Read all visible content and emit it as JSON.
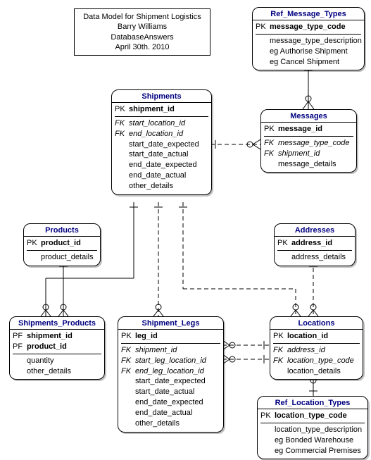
{
  "title_box": {
    "line1": "Data Model for Shipment Logistics",
    "line2": "Barry Williams",
    "line3": "DatabaseAnswers",
    "line4": "April 30th. 2010"
  },
  "entities": {
    "ref_message_types": {
      "title": "Ref_Message_Types",
      "pk_rows": [
        {
          "key": "PK",
          "name": "message_type_code",
          "cls": "pk-name"
        }
      ],
      "rows": [
        {
          "key": "",
          "name": "message_type_description",
          "cls": ""
        },
        {
          "key": "",
          "name": "eg Authorise Shipment",
          "cls": ""
        },
        {
          "key": "",
          "name": "eg Cancel Shipment",
          "cls": ""
        }
      ]
    },
    "messages": {
      "title": "Messages",
      "pk_rows": [
        {
          "key": "PK",
          "name": "message_id",
          "cls": "pk-name"
        }
      ],
      "rows": [
        {
          "key": "FK",
          "name": "message_type_code",
          "cls": "fk-name"
        },
        {
          "key": "FK",
          "name": "shipment_id",
          "cls": "fk-name"
        },
        {
          "key": "",
          "name": "message_details",
          "cls": ""
        }
      ]
    },
    "shipments": {
      "title": "Shipments",
      "pk_rows": [
        {
          "key": "PK",
          "name": "shipment_id",
          "cls": "pk-name"
        }
      ],
      "rows": [
        {
          "key": "FK",
          "name": "start_location_id",
          "cls": "fk-name"
        },
        {
          "key": "FK",
          "name": "end_location_id",
          "cls": "fk-name"
        },
        {
          "key": "",
          "name": "start_date_expected",
          "cls": ""
        },
        {
          "key": "",
          "name": "start_date_actual",
          "cls": ""
        },
        {
          "key": "",
          "name": "end_date_expected",
          "cls": ""
        },
        {
          "key": "",
          "name": "end_date_actual",
          "cls": ""
        },
        {
          "key": "",
          "name": "other_details",
          "cls": ""
        }
      ]
    },
    "products": {
      "title": "Products",
      "pk_rows": [
        {
          "key": "PK",
          "name": "product_id",
          "cls": "pk-name"
        }
      ],
      "rows": [
        {
          "key": "",
          "name": "product_details",
          "cls": ""
        }
      ]
    },
    "addresses": {
      "title": "Addresses",
      "pk_rows": [
        {
          "key": "PK",
          "name": "address_id",
          "cls": "pk-name"
        }
      ],
      "rows": [
        {
          "key": "",
          "name": "address_details",
          "cls": ""
        }
      ]
    },
    "shipments_products": {
      "title": "Shipments_Products",
      "pk_rows": [
        {
          "key": "PF",
          "name": "shipment_id",
          "cls": "pk-name"
        },
        {
          "key": "PF",
          "name": "product_id",
          "cls": "pk-name"
        }
      ],
      "rows": [
        {
          "key": "",
          "name": "quantity",
          "cls": ""
        },
        {
          "key": "",
          "name": "other_details",
          "cls": ""
        }
      ]
    },
    "shipment_legs": {
      "title": "Shipment_Legs",
      "pk_rows": [
        {
          "key": "PK",
          "name": "leg_id",
          "cls": "pk-name"
        }
      ],
      "rows": [
        {
          "key": "FK",
          "name": "shipment_id",
          "cls": "fk-name"
        },
        {
          "key": "FK",
          "name": "start_leg_location_id",
          "cls": "fk-name"
        },
        {
          "key": "FK",
          "name": "end_leg_location_id",
          "cls": "fk-name"
        },
        {
          "key": "",
          "name": "start_date_expected",
          "cls": ""
        },
        {
          "key": "",
          "name": "start_date_actual",
          "cls": ""
        },
        {
          "key": "",
          "name": "end_date_expected",
          "cls": ""
        },
        {
          "key": "",
          "name": "end_date_actual",
          "cls": ""
        },
        {
          "key": "",
          "name": "other_details",
          "cls": ""
        }
      ]
    },
    "locations": {
      "title": "Locations",
      "pk_rows": [
        {
          "key": "PK",
          "name": "location_id",
          "cls": "pk-name"
        }
      ],
      "rows": [
        {
          "key": "FK",
          "name": "address_id",
          "cls": "fk-name"
        },
        {
          "key": "FK",
          "name": "location_type_code",
          "cls": "fk-name"
        },
        {
          "key": "",
          "name": "location_details",
          "cls": ""
        }
      ]
    },
    "ref_location_types": {
      "title": "Ref_Location_Types",
      "pk_rows": [
        {
          "key": "PK",
          "name": "location_type_code",
          "cls": "pk-name"
        }
      ],
      "rows": [
        {
          "key": "",
          "name": "location_type_description",
          "cls": ""
        },
        {
          "key": "",
          "name": "eg Bonded Warehouse",
          "cls": ""
        },
        {
          "key": "",
          "name": "eg Commercial Premises",
          "cls": ""
        }
      ]
    }
  }
}
